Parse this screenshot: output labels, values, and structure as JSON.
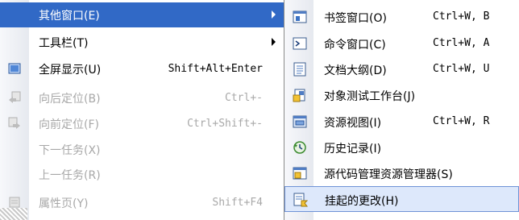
{
  "main_menu": {
    "items": [
      {
        "label": "其他窗口(E)",
        "shortcut": "",
        "icon": "",
        "submenu": true,
        "highlighted": true,
        "disabled": false
      },
      {
        "label": "工具栏(T)",
        "shortcut": "",
        "icon": "",
        "submenu": true,
        "highlighted": false,
        "disabled": false
      },
      {
        "label": "全屏显示(U)",
        "shortcut": "Shift+Alt+Enter",
        "icon": "fullscreen-icon",
        "submenu": false,
        "highlighted": false,
        "disabled": false
      },
      {
        "label": "向后定位(B)",
        "shortcut": "Ctrl+-",
        "icon": "navigate-backward-icon",
        "submenu": false,
        "highlighted": false,
        "disabled": true
      },
      {
        "label": "向前定位(F)",
        "shortcut": "Ctrl+Shift+-",
        "icon": "navigate-forward-icon",
        "submenu": false,
        "highlighted": false,
        "disabled": true
      },
      {
        "label": "下一任务(X)",
        "shortcut": "",
        "icon": "",
        "submenu": false,
        "highlighted": false,
        "disabled": true
      },
      {
        "label": "上一任务(R)",
        "shortcut": "",
        "icon": "",
        "submenu": false,
        "highlighted": false,
        "disabled": true
      },
      {
        "label": "属性页(Y)",
        "shortcut": "Shift+F4",
        "icon": "property-pages-icon",
        "submenu": false,
        "highlighted": false,
        "disabled": true
      }
    ]
  },
  "sub_menu": {
    "items": [
      {
        "label": "书签窗口(O)",
        "shortcut": "Ctrl+W, B",
        "icon": "bookmark-window-icon"
      },
      {
        "label": "命令窗口(C)",
        "shortcut": "Ctrl+W, A",
        "icon": "command-window-icon"
      },
      {
        "label": "文档大纲(D)",
        "shortcut": "Ctrl+W, U",
        "icon": "document-outline-icon"
      },
      {
        "label": "对象测试工作台(J)",
        "shortcut": "",
        "icon": "object-test-bench-icon"
      },
      {
        "label": "资源视图(I)",
        "shortcut": "Ctrl+W, R",
        "icon": "resource-view-icon"
      },
      {
        "label": "历史记录(I)",
        "shortcut": "",
        "icon": "history-icon"
      },
      {
        "label": "源代码管理资源管理器(S)",
        "shortcut": "",
        "icon": "source-control-explorer-icon"
      },
      {
        "label": "挂起的更改(H)",
        "shortcut": "",
        "icon": "pending-changes-icon",
        "highlighted": true
      }
    ]
  },
  "colors": {
    "highlight": "#3169c6",
    "hover": "#dde8fb",
    "disabled_text": "#a8a8a8"
  }
}
